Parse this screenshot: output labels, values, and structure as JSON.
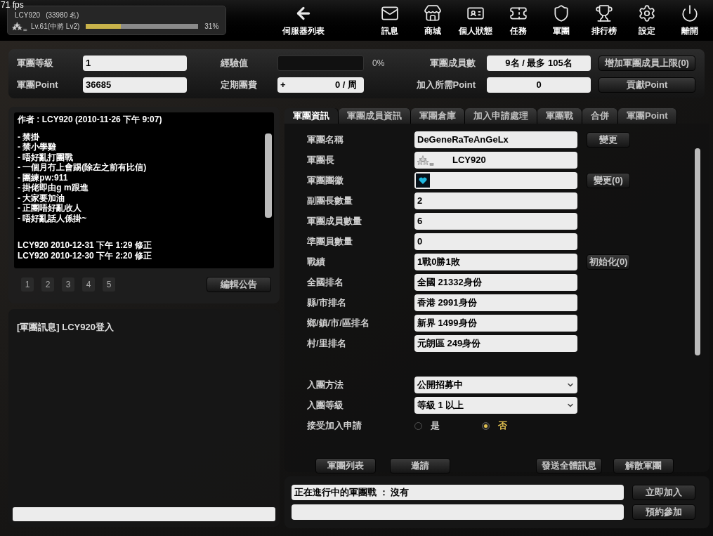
{
  "fps": "71 fps",
  "player": {
    "name": "LCY920",
    "rank_count": "(33980 名)",
    "level": "Lv.61(中將 Lv2)",
    "exp": {
      "level": 0.31,
      "reading": "31%"
    }
  },
  "nav": [
    {
      "label": "伺服器列表",
      "kind": "back"
    },
    {
      "label": "訊息",
      "kind": "mail"
    },
    {
      "label": "商城",
      "kind": "store"
    },
    {
      "label": "個人狀態",
      "kind": "profile"
    },
    {
      "label": "任務",
      "kind": "ticket"
    },
    {
      "label": "軍團",
      "kind": "clan"
    },
    {
      "label": "排行榜",
      "kind": "trophy"
    },
    {
      "label": "設定",
      "kind": "settings"
    },
    {
      "label": "離開",
      "kind": "power"
    }
  ],
  "summary": {
    "rows": [
      {
        "label": "軍團等級",
        "value": "1",
        "label2": "經驗值",
        "meter": {
          "level": 0,
          "reading": "0%"
        },
        "label3": "軍團成員數",
        "value3": "9名 / 最多 105名",
        "button": "增加軍團成員上限(0)"
      },
      {
        "label": "軍團Point",
        "value": "36685",
        "label2": "定期團費",
        "fee": {
          "prefix": "+",
          "value": "0 / 周"
        },
        "label3": "加入所需Point",
        "value3": "0",
        "button": "貢獻Point"
      }
    ]
  },
  "notice": {
    "author": "作者 : LCY920 (2010-11-26 下午 9:07)",
    "lines": [
      "- 禁掛",
      "- 禁小學雞",
      "- 唔好亂打團戰",
      "- 一個月冇上會踢(除左之前有比信)",
      "- 團練pw:911",
      "- 掛佬即由g m跟進",
      "- 大家要加油",
      "- 正團唔好亂收人",
      "- 唔好亂話人係掛~"
    ],
    "edits": [
      "LCY920 2010-12-31 下午 1:29 修正",
      "LCY920 2010-12-30 下午 2:20 修正"
    ],
    "pages": [
      {
        "label": "1",
        "selected": false
      },
      {
        "label": "2",
        "selected": false
      },
      {
        "label": "3",
        "selected": false
      },
      {
        "label": "4",
        "selected": false
      },
      {
        "label": "5",
        "selected": false
      }
    ],
    "edit_button": "編輯公告"
  },
  "chat": {
    "messages": [
      "[軍團訊息] LCY920登入"
    ]
  },
  "tabs": [
    {
      "label": "軍團資訊",
      "selected": true
    },
    {
      "label": "軍團成員資訊",
      "selected": false
    },
    {
      "label": "軍團倉庫",
      "selected": false
    },
    {
      "label": "加入申請處理",
      "selected": false
    },
    {
      "label": "軍團戰",
      "selected": false
    },
    {
      "label": "合併",
      "selected": false
    },
    {
      "label": "軍團Point",
      "selected": false
    }
  ],
  "info_rows": [
    {
      "label": "軍團名稱",
      "kind": "text",
      "value": "DeGeneRaTeAnGeLx",
      "button": "變更"
    },
    {
      "label": "軍團長",
      "kind": "leader",
      "value": "LCY920"
    },
    {
      "label": "軍團團徽",
      "kind": "emblem",
      "button": "變更(0)"
    },
    {
      "label": "副團長數量",
      "kind": "text",
      "value": "2"
    },
    {
      "label": "軍團成員數量",
      "kind": "text",
      "value": "6"
    },
    {
      "label": "準團員數量",
      "kind": "text",
      "value": "0"
    },
    {
      "label": "戰績",
      "kind": "text",
      "value": "1戰0勝1敗",
      "button": "初始化(0)"
    },
    {
      "label": "全國排名",
      "kind": "text",
      "value": "全國  21332身份"
    },
    {
      "label": "縣/市排名",
      "kind": "text",
      "value": "香港    2991身份"
    },
    {
      "label": "鄉/鎮/市/區排名",
      "kind": "text",
      "value": "新界    1499身份"
    },
    {
      "label": "村/里排名",
      "kind": "text",
      "value": "元朗區     249身份"
    }
  ],
  "join_settings": [
    {
      "label": "入團方法",
      "kind": "select",
      "value": "公開招募中"
    },
    {
      "label": "入團等級",
      "kind": "select",
      "value": "等級  1 以上"
    },
    {
      "label": "接受加入申請",
      "kind": "radio",
      "options": [
        {
          "label": "是",
          "selected": false
        },
        {
          "label": "否",
          "selected": true
        }
      ]
    }
  ],
  "actions": [
    "軍團列表",
    "邀請",
    "發送全體訊息",
    "解散軍團"
  ],
  "war": {
    "status": "正在進行中的軍團戰 ： 沒有",
    "buttons": [
      "立即加入",
      "預約參加"
    ]
  }
}
